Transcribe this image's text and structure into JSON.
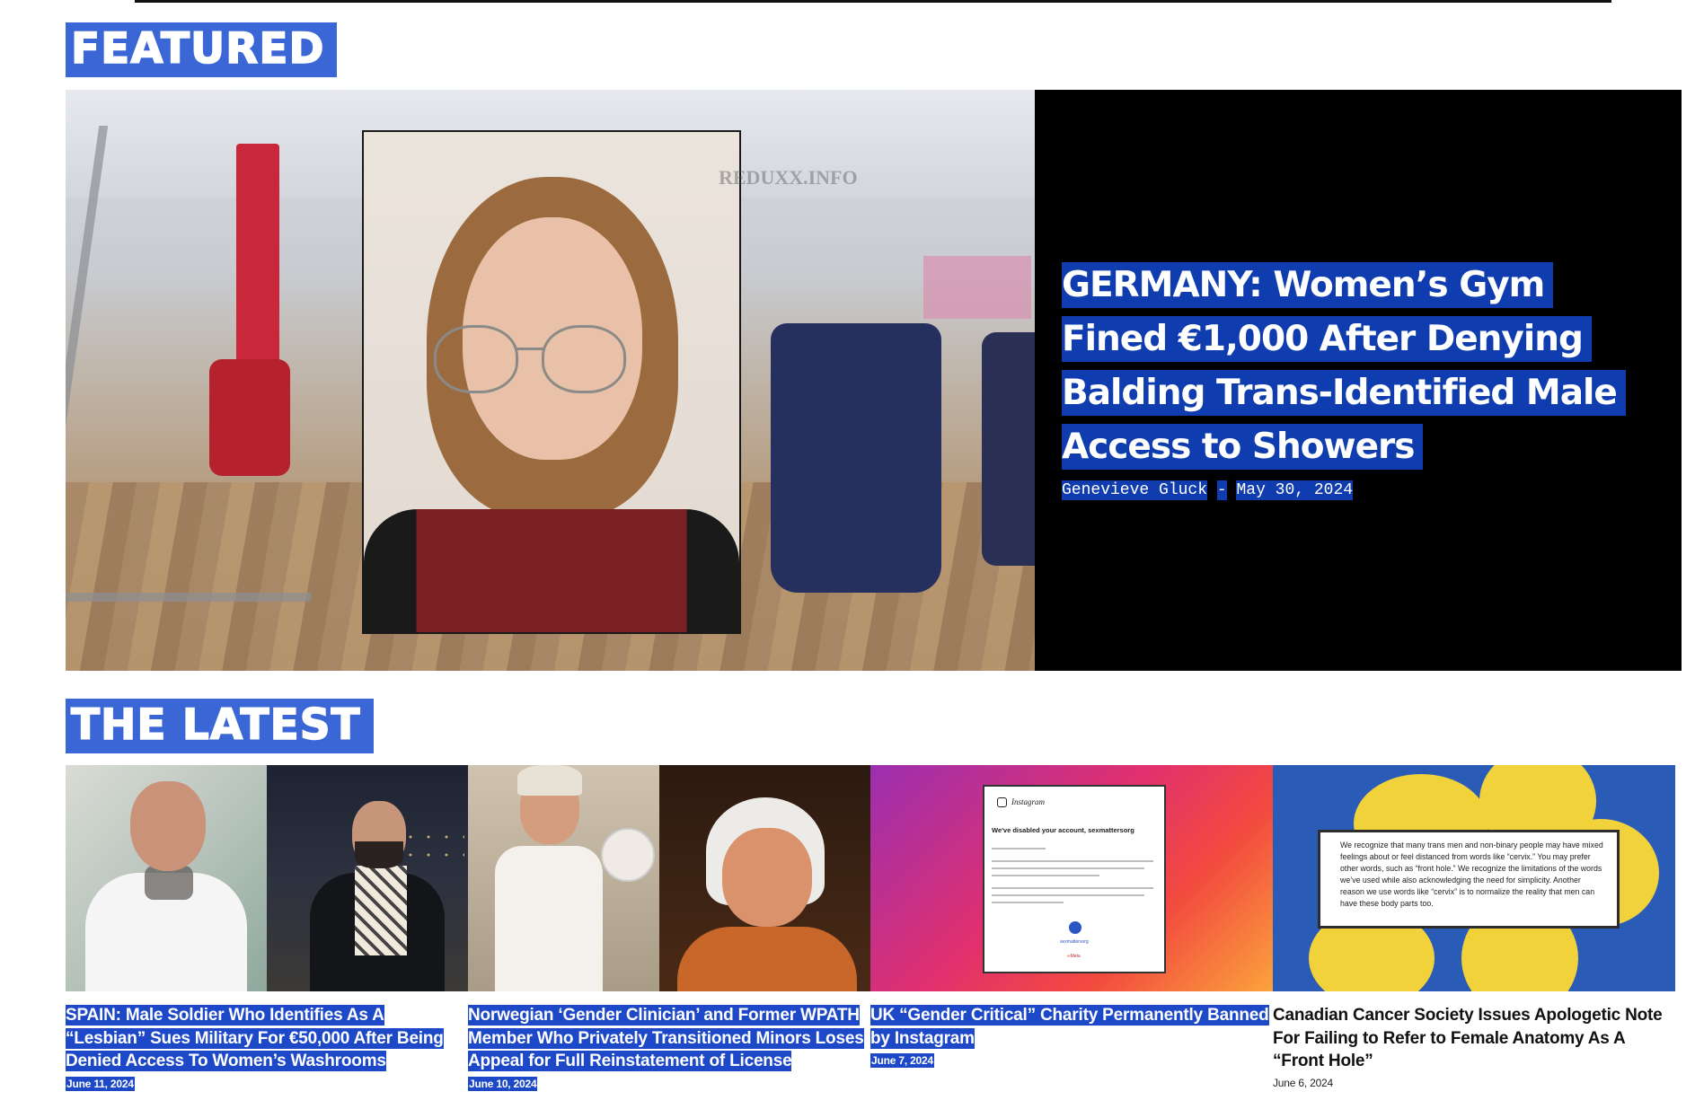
{
  "sections": {
    "featured_label": "FEATURED",
    "latest_label": "THE LATEST"
  },
  "featured": {
    "watermark": "REDUXX.INFO",
    "title": "GERMANY: Women’s Gym Fined €1,000 After Denying Balding Trans-Identified Male Access to Showers",
    "author": "Genevieve Gluck",
    "separator": "-",
    "date": "May 30, 2024"
  },
  "latest": [
    {
      "title": "SPAIN: Male Soldier Who Identifies As A “Lesbian” Sues Military For €50,000 After Being Denied Access To Women’s Washrooms",
      "date": "June 11, 2024"
    },
    {
      "title": "Norwegian ‘Gender Clinician’ and Former WPATH Member Who Privately Transitioned Minors Loses Appeal for Full Reinstatement of License",
      "date": "June 10, 2024"
    },
    {
      "title": "UK “Gender Critical” Charity Permanently Banned by Instagram",
      "date": "June 7, 2024",
      "image_text": {
        "brand": "Instagram",
        "heading": "We've disabled your account, sexmattersorg",
        "handle": "sexmattersorg",
        "footer": "∞Meta"
      }
    },
    {
      "title": "Canadian Cancer Society Issues Apologetic Note For Failing to Refer to Female Anatomy As A “Front Hole”",
      "date": "June 6, 2024",
      "image_text": {
        "note": "We recognize that many trans men and non-binary people may have mixed feelings about or feel distanced from words like “cervix.” You may prefer other words, such as “front hole.” We recognize the limitations of the words we’ve used while also acknowledging the need for simplicity. Another reason we use words like “cervix” is to normalize the reality that men can have these body parts too."
      }
    }
  ],
  "colors": {
    "label_bg": "#3a66d6",
    "highlight": "#0f3cae",
    "hero_panel": "#000000"
  }
}
